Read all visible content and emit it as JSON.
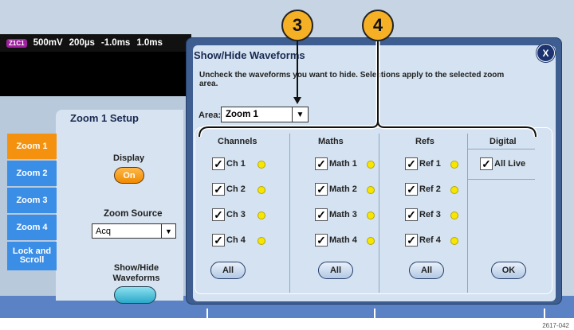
{
  "status_bar": {
    "badge": "Z1C1",
    "readouts": [
      "500mV",
      "200µs",
      "-1.0ms",
      "1.0ms"
    ]
  },
  "zoom_setup": {
    "title": "Zoom 1 Setup",
    "tabs": [
      "Zoom 1",
      "Zoom 2",
      "Zoom 3",
      "Zoom 4",
      "Lock and Scroll"
    ],
    "display_label": "Display",
    "display_button": "On",
    "zoom_source_label": "Zoom Source",
    "zoom_source_value": "Acq",
    "show_hide_label": "Show/Hide Waveforms"
  },
  "dialog": {
    "title": "Show/Hide Waveforms",
    "instructions": "Uncheck the waveforms you want to hide. Selections apply to the selected zoom area.",
    "area_label": "Area:",
    "area_value": "Zoom 1",
    "close_label": "X",
    "groups": {
      "channels": {
        "title": "Channels",
        "items": [
          "Ch 1",
          "Ch 2",
          "Ch 3",
          "Ch 4"
        ],
        "all_button": "All"
      },
      "maths": {
        "title": "Maths",
        "items": [
          "Math 1",
          "Math 2",
          "Math 3",
          "Math 4"
        ],
        "all_button": "All"
      },
      "refs": {
        "title": "Refs",
        "items": [
          "Ref 1",
          "Ref 2",
          "Ref 3",
          "Ref 4"
        ],
        "all_button": "All"
      },
      "digital": {
        "title": "Digital",
        "items": [
          "All Live"
        ],
        "ok_button": "OK"
      }
    }
  },
  "callouts": [
    "3",
    "4"
  ],
  "figure_code": "2617-042",
  "colors": {
    "accent_orange": "#f4920f",
    "tab_blue": "#3b8ee6",
    "dialog_frame": "#3e5d90",
    "led_yellow": "#f6e600",
    "callout": "#f5b026"
  }
}
